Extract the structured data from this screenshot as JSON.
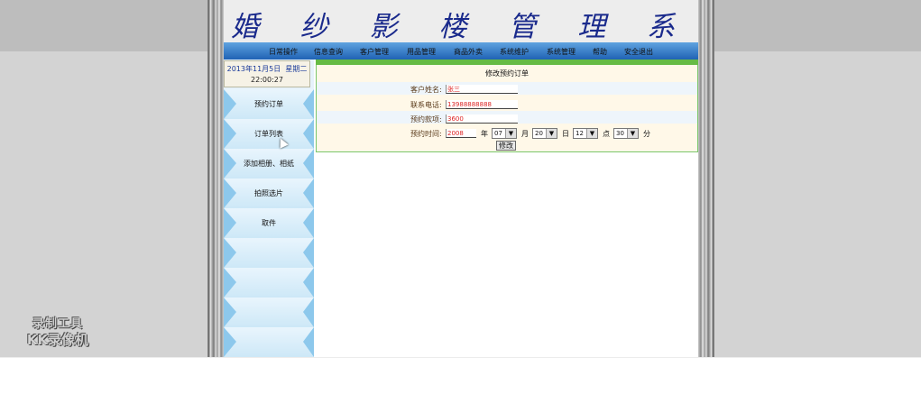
{
  "app": {
    "title": "婚 纱 影 楼 管 理 系 统"
  },
  "nav": [
    {
      "label": "日常操作"
    },
    {
      "label": "信息查询"
    },
    {
      "label": "客户管理"
    },
    {
      "label": "用品管理"
    },
    {
      "label": "商品外卖"
    },
    {
      "label": "系统维护"
    },
    {
      "label": "系统管理"
    },
    {
      "label": "帮助"
    },
    {
      "label": "安全退出"
    }
  ],
  "date": {
    "date_text": "2013年11月5日",
    "weekday": "星期二",
    "time": "22:00:27"
  },
  "sidebar": {
    "items": [
      {
        "label": "预约订单"
      },
      {
        "label": "订单列表"
      },
      {
        "label": "添加相册、相纸"
      },
      {
        "label": "拍照选片"
      },
      {
        "label": "取件"
      },
      {
        "label": ""
      },
      {
        "label": ""
      },
      {
        "label": ""
      },
      {
        "label": ""
      }
    ]
  },
  "form": {
    "title": "修改预约订单",
    "customer_label": "客户姓名:",
    "customer_value": "张三",
    "phone_label": "联系电话:",
    "phone_value": "13988888888",
    "amount_label": "预约款项:",
    "amount_value": "3600",
    "time_label": "预约时间:",
    "year_value": "2008",
    "year_unit": "年",
    "month_value": "07",
    "month_unit": "月",
    "day_value": "20",
    "day_unit": "日",
    "hour_value": "12",
    "hour_unit": "点",
    "minute_value": "30",
    "minute_unit": "分",
    "submit_label": "修改"
  },
  "watermark": {
    "line1": "录制工具",
    "line2": "KK录像机"
  },
  "colors": {
    "title": "#1a2a8c",
    "nav_top": "#5fa3e0",
    "nav_bottom": "#1f62b4",
    "green_bar": "#66bb44",
    "input_text": "#dd2222"
  }
}
